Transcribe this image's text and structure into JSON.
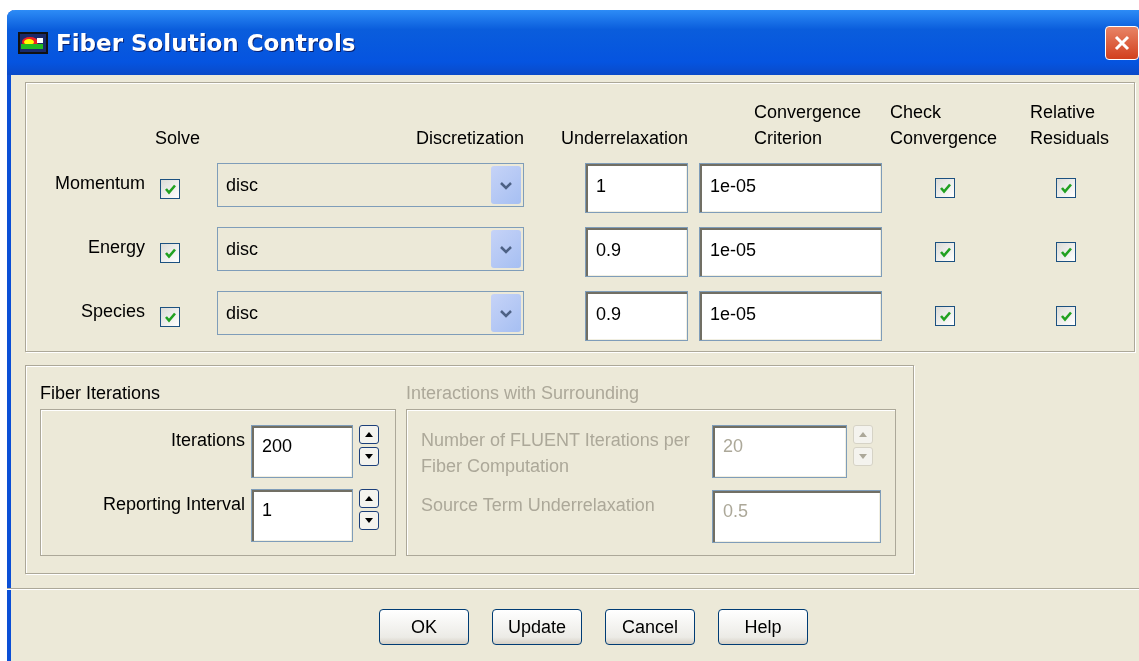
{
  "window": {
    "title": "Fiber Solution Controls"
  },
  "equations": {
    "headers": {
      "solve": "Solve",
      "discretization": "Discretization",
      "underrelaxation": "Underrelaxation",
      "criterion": "Convergence Criterion",
      "check_convergence": "Check Convergence",
      "relative_residuals": "Relative Residuals"
    },
    "rows": [
      {
        "label": "Momentum",
        "solve": true,
        "discretization": "disc",
        "underrelaxation": "1",
        "criterion": "1e-05",
        "check_convergence": true,
        "relative_residuals": true
      },
      {
        "label": "Energy",
        "solve": true,
        "discretization": "disc",
        "underrelaxation": "0.9",
        "criterion": "1e-05",
        "check_convergence": true,
        "relative_residuals": true
      },
      {
        "label": "Species",
        "solve": true,
        "discretization": "disc",
        "underrelaxation": "0.9",
        "criterion": "1e-05",
        "check_convergence": true,
        "relative_residuals": true
      }
    ]
  },
  "fiber_iterations": {
    "title": "Fiber Iterations",
    "disabled": false,
    "fields": [
      {
        "label": "Iterations",
        "value": "200",
        "kind": "spinner"
      },
      {
        "label": "Reporting Interval",
        "value": "1",
        "kind": "spinner"
      }
    ]
  },
  "interactions": {
    "title": "Interactions with Surrounding",
    "disabled": true,
    "fields": [
      {
        "label": "Number of FLUENT Iterations per Fiber Computation",
        "value": "20",
        "kind": "spinner"
      },
      {
        "label": "Source Term Underrelaxation",
        "value": "0.5",
        "kind": "text"
      }
    ]
  },
  "buttons": [
    "OK",
    "Update",
    "Cancel",
    "Help"
  ]
}
